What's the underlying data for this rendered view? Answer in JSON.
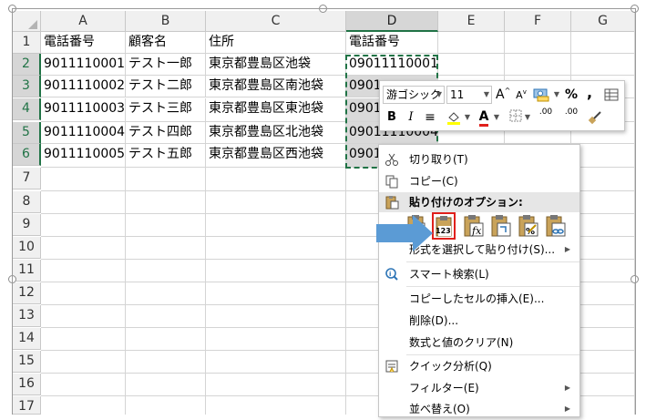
{
  "columns": [
    "A",
    "B",
    "C",
    "D",
    "E",
    "F",
    "G"
  ],
  "rows": [
    "1",
    "2",
    "3",
    "4",
    "5",
    "6",
    "7",
    "8",
    "9",
    "10",
    "11",
    "12",
    "13",
    "14",
    "15",
    "16",
    "17"
  ],
  "cells": [
    [
      "電話番号",
      "顧客名",
      "住所",
      "電話番号"
    ],
    [
      "9011110001",
      "テスト一郎",
      "東京都豊島区池袋",
      "09011110001"
    ],
    [
      "9011110002",
      "テスト二郎",
      "東京都豊島区南池袋",
      "0901"
    ],
    [
      "9011110003",
      "テスト三郎",
      "東京都豊島区東池袋",
      "0901"
    ],
    [
      "9011110004",
      "テスト四郎",
      "東京都豊島区北池袋",
      "09011110004"
    ],
    [
      "9011110005",
      "テスト五郎",
      "東京都豊島区西池袋",
      "0901"
    ]
  ],
  "mini_toolbar": {
    "font_name": "游ゴシック",
    "font_size": "11",
    "grow_font": "A",
    "shrink_font": "A",
    "percent": "%",
    "comma": ",",
    "bold": "B",
    "italic": "I",
    "align": "≡",
    "font_color_letter": "A",
    "inc_decimal": ".00",
    "dec_decimal": ".00"
  },
  "context_menu": {
    "cut": "切り取り(T)",
    "copy": "コピー(C)",
    "paste_options_header": "貼り付けのオプション:",
    "paste_values_label": "123",
    "paste_special": "形式を選択して貼り付け(S)...",
    "smart_lookup": "スマート検索(L)",
    "insert_copied": "コピーしたセルの挿入(E)...",
    "delete": "削除(D)...",
    "clear_contents": "数式と値のクリア(N)",
    "quick_analysis": "クイック分析(Q)",
    "filter": "フィルター(E)",
    "sort": "並べ替え(O)"
  },
  "colors": {
    "excel_green": "#217346",
    "arrow_blue": "#5b9bd5",
    "highlight_red": "#e0201c",
    "header_bg": "#f0f0f0",
    "selected_header_bg": "#d6d6d6"
  }
}
